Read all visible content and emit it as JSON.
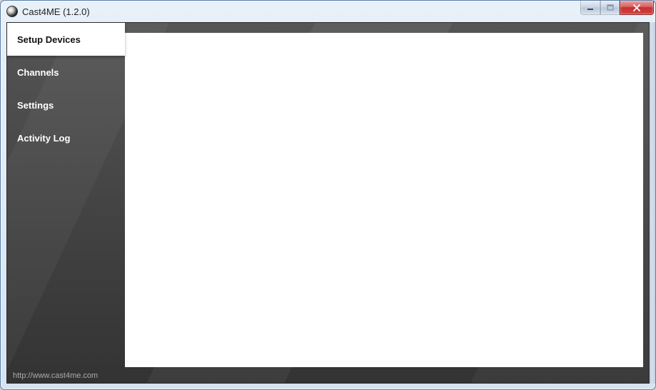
{
  "window": {
    "title": "Cast4ME (1.2.0)"
  },
  "sidebar": {
    "items": [
      {
        "label": "Setup Devices",
        "active": true
      },
      {
        "label": "Channels",
        "active": false
      },
      {
        "label": "Settings",
        "active": false
      },
      {
        "label": "Activity Log",
        "active": false
      }
    ]
  },
  "footer": {
    "url": "http://www.cast4me.com"
  }
}
